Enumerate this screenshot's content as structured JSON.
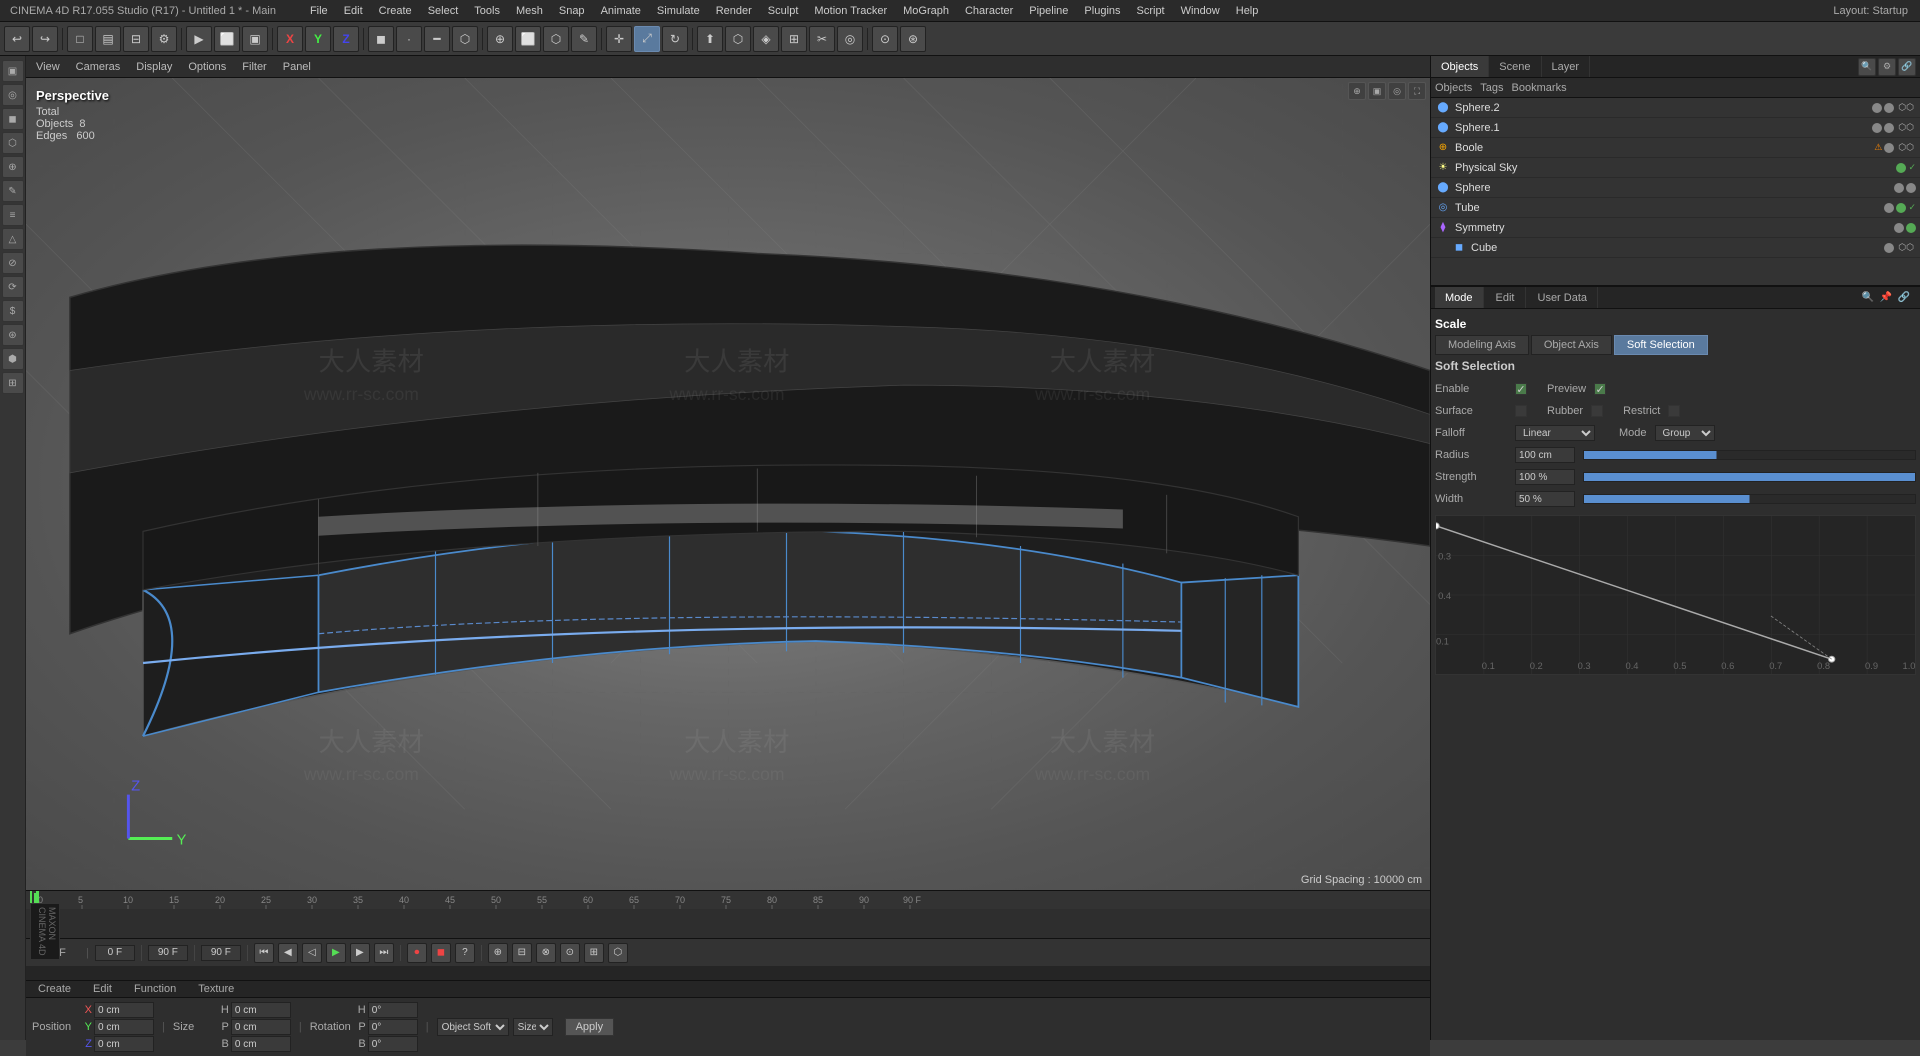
{
  "app": {
    "title": "CINEMA 4D R17.055 Studio (R17) - Untitled 1 * - Main",
    "layout": "Startup"
  },
  "menu": {
    "items": [
      "File",
      "Edit",
      "Create",
      "Select",
      "Tools",
      "Mesh",
      "Snap",
      "Animate",
      "Simulate",
      "Render",
      "Sculpt",
      "Motion Tracker",
      "MoGraph",
      "Character",
      "Pipeline",
      "Plugins",
      "Script",
      "Window",
      "Help"
    ]
  },
  "viewport": {
    "label": "Perspective",
    "stats": {
      "total_label": "Total",
      "objects_label": "Objects",
      "objects_value": "8",
      "edges_label": "Edges",
      "edges_value": "600"
    },
    "grid_spacing": "Grid Spacing : 10000 cm",
    "menu_items": [
      "View",
      "Cameras",
      "Display",
      "Options",
      "Filter",
      "Panel"
    ]
  },
  "toolbar": {
    "axis_x": "X",
    "axis_y": "Y",
    "axis_z": "Z"
  },
  "object_manager": {
    "tabs": [
      "Objects",
      "Scene",
      "Layer"
    ],
    "toolbar_buttons": [
      "Create",
      "Edit",
      "Function",
      "Texture"
    ],
    "objects": [
      {
        "name": "Sphere.2",
        "indent": 0,
        "icon": "⬤",
        "icon_color": "#6af",
        "has_tag": true
      },
      {
        "name": "Sphere.1",
        "indent": 0,
        "icon": "⬤",
        "icon_color": "#6af",
        "has_tag": true
      },
      {
        "name": "Boole",
        "indent": 0,
        "icon": "⊕",
        "icon_color": "#fa0",
        "has_warning": true
      },
      {
        "name": "Physical Sky",
        "indent": 0,
        "icon": "☀",
        "icon_color": "#ff8"
      },
      {
        "name": "Sphere",
        "indent": 0,
        "icon": "⬤",
        "icon_color": "#6af"
      },
      {
        "name": "Tube",
        "indent": 0,
        "icon": "◎",
        "icon_color": "#6af"
      },
      {
        "name": "Symmetry",
        "indent": 0,
        "icon": "⧫",
        "icon_color": "#a6f"
      },
      {
        "name": "Cube",
        "indent": 1,
        "icon": "◼",
        "icon_color": "#6af"
      }
    ]
  },
  "properties_panel": {
    "tabs": [
      "Mode",
      "Edit",
      "User Data"
    ],
    "scale_title": "Scale",
    "scale_tabs": [
      "Modeling Axis",
      "Object Axis",
      "Soft Selection"
    ],
    "soft_selection": {
      "title": "Soft Selection",
      "enable_label": "Enable",
      "enable_checked": true,
      "preview_label": "Preview",
      "preview_checked": true,
      "surface_label": "Surface",
      "rubber_label": "Rubber",
      "restrict_label": "Restrict",
      "falloff_label": "Falloff",
      "falloff_value": "Linear",
      "mode_label": "Mode",
      "mode_value": "Group",
      "radius_label": "Radius",
      "radius_value": "100 cm",
      "radius_pct": 40,
      "strength_label": "Strength",
      "strength_value": "100 %",
      "strength_pct": 100,
      "width_label": "Width",
      "width_value": "50 %",
      "width_pct": 50
    }
  },
  "timeline": {
    "frames": [
      "0",
      "5",
      "10",
      "15",
      "20",
      "25",
      "30",
      "35",
      "40",
      "45",
      "50",
      "55",
      "60",
      "65",
      "70",
      "75",
      "80",
      "85",
      "90"
    ],
    "current_frame": "0 F",
    "end_frame": "90 F",
    "fps_display": "90 F"
  },
  "transform": {
    "position_label": "Position",
    "size_label": "Size",
    "rotation_label": "Rotation",
    "x_label": "X",
    "y_label": "Y",
    "z_label": "Z",
    "h_label": "H",
    "p_label": "P",
    "b_label": "B",
    "pos_x": "0 cm",
    "pos_y": "0 cm",
    "pos_z": "0 cm",
    "size_x": "0 cm",
    "size_y": "0 cm",
    "size_z": "0 cm",
    "rot_h": "0°",
    "rot_p": "0°",
    "rot_b": "0°",
    "apply_label": "Apply",
    "mode_label": "Object Soft"
  },
  "bottom_tabs": {
    "items": [
      "Create",
      "Edit",
      "Function",
      "Texture"
    ]
  },
  "icons": {
    "undo": "↩",
    "redo": "↪",
    "new": "□",
    "open": "📂",
    "save": "💾",
    "render": "▶",
    "play": "▶",
    "stop": "■",
    "prev": "◀◀",
    "next": "▶▶",
    "rewind": "⏮",
    "forward": "⏭",
    "record": "⏺",
    "loop": "🔄"
  }
}
